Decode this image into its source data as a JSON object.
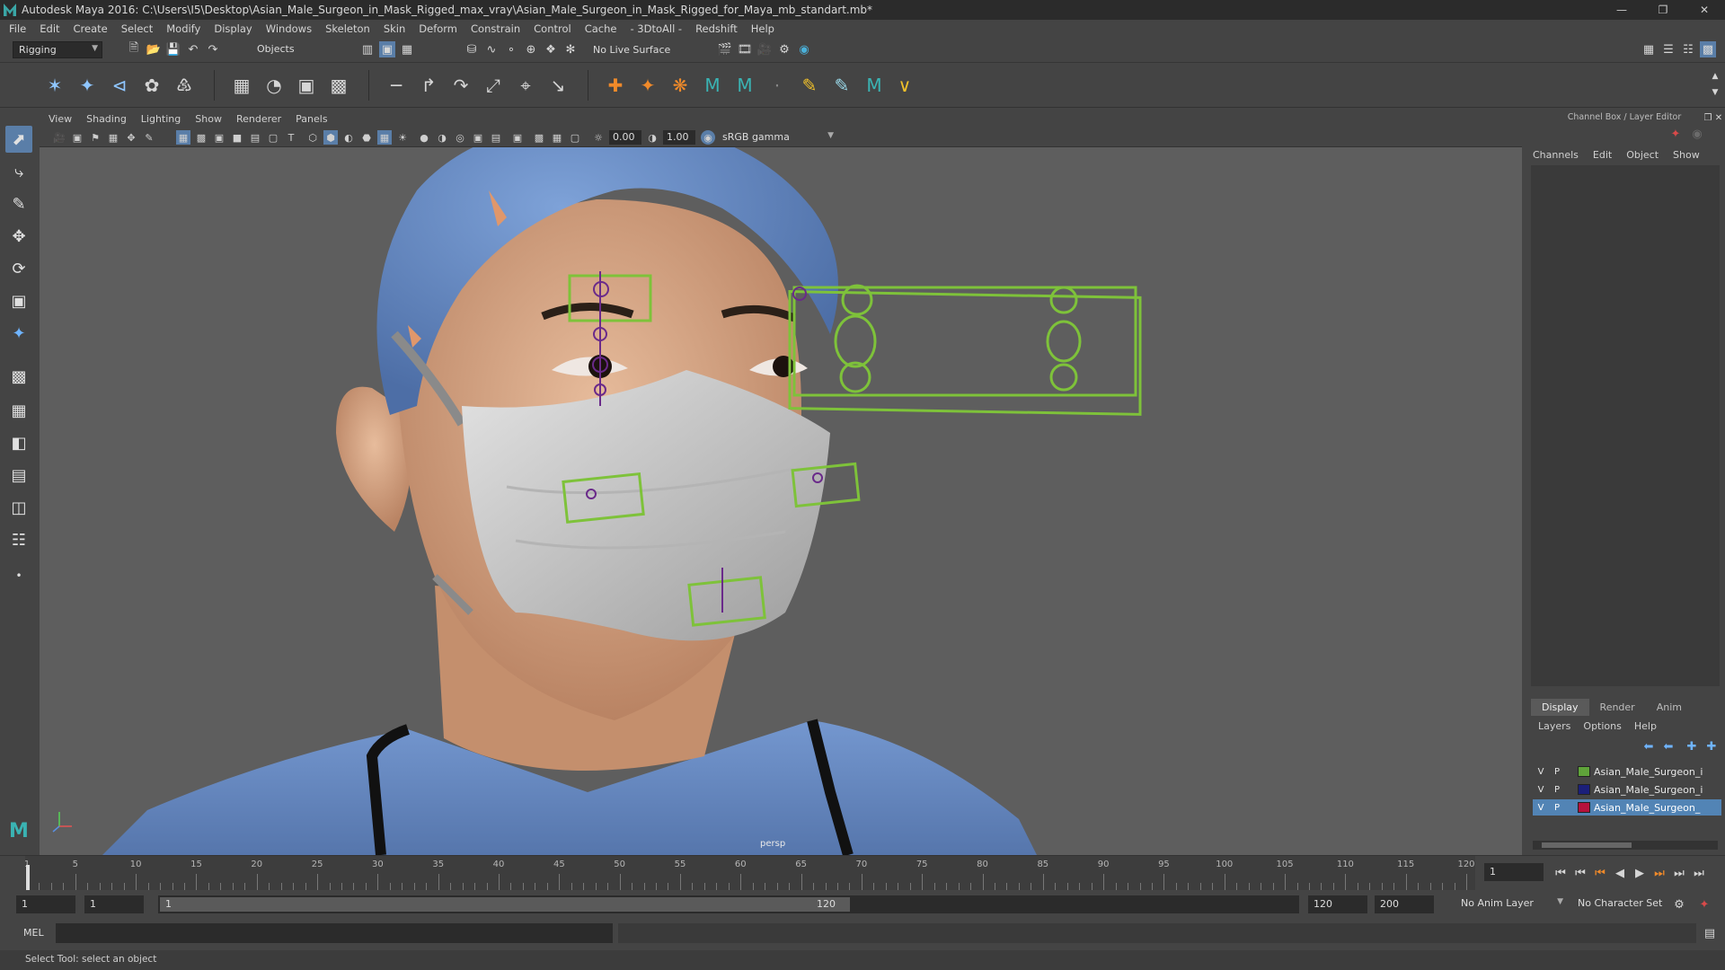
{
  "window": {
    "title": "Autodesk Maya 2016: C:\\Users\\I5\\Desktop\\Asian_Male_Surgeon_in_Mask_Rigged_max_vray\\Asian_Male_Surgeon_in_Mask_Rigged_for_Maya_mb_standart.mb*"
  },
  "menubar": {
    "items": [
      "File",
      "Edit",
      "Create",
      "Select",
      "Modify",
      "Display",
      "Windows",
      "Skeleton",
      "Skin",
      "Deform",
      "Constrain",
      "Control",
      "Cache",
      "- 3DtoAll -",
      "Redshift",
      "Help"
    ]
  },
  "statusline": {
    "mode": "Rigging",
    "selection_mask": "Objects",
    "live_surface": "No Live Surface"
  },
  "panel": {
    "menus": [
      "View",
      "Shading",
      "Lighting",
      "Show",
      "Renderer",
      "Panels"
    ],
    "exposure": "0.00",
    "gamma": "1.00",
    "color_space": "sRGB gamma",
    "camera_label": "persp"
  },
  "channelbox": {
    "title": "Channel Box / Layer Editor",
    "menus": [
      "Channels",
      "Edit",
      "Object",
      "Show"
    ],
    "tabs": [
      "Display",
      "Render",
      "Anim"
    ],
    "layer_menus": [
      "Layers",
      "Options",
      "Help"
    ],
    "layers": [
      {
        "v": "V",
        "p": "P",
        "name": "Asian_Male_Surgeon_i",
        "color": "#5fa33a"
      },
      {
        "v": "V",
        "p": "P",
        "name": "Asian_Male_Surgeon_i",
        "color": "#1b1f7a"
      },
      {
        "v": "V",
        "p": "P",
        "name": "Asian_Male_Surgeon_",
        "color": "#b5123c"
      }
    ]
  },
  "timeline": {
    "labels": [
      "1",
      "5",
      "10",
      "15",
      "20",
      "25",
      "30",
      "35",
      "40",
      "45",
      "50",
      "55",
      "60",
      "65",
      "70",
      "75",
      "80",
      "85",
      "90",
      "95",
      "100",
      "105",
      "110",
      "115",
      "120"
    ],
    "current_frame": "1"
  },
  "range": {
    "start": "1",
    "playback_start": "1",
    "slider_start": "1",
    "slider_end": "120",
    "playback_end": "120",
    "end": "200",
    "anim_layer": "No Anim Layer",
    "character_set": "No Character Set"
  },
  "mel": {
    "label": "MEL"
  },
  "helpline": {
    "text": "Select Tool: select an object"
  },
  "colors": {
    "accent": "#5284b5",
    "rig_controls": "#7ec23a",
    "scrubs": "#6b8fcb"
  }
}
